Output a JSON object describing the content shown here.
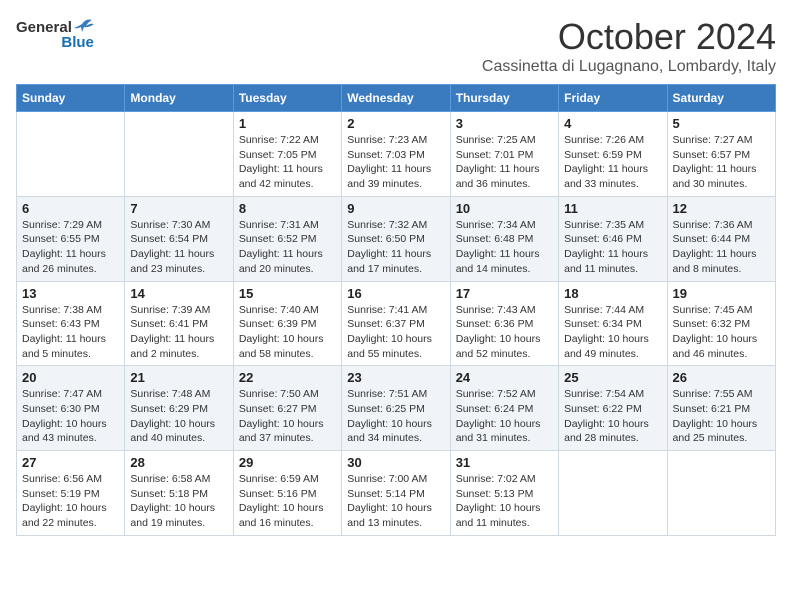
{
  "logo": {
    "general": "General",
    "blue": "Blue"
  },
  "header": {
    "month": "October 2024",
    "location": "Cassinetta di Lugagnano, Lombardy, Italy"
  },
  "weekdays": [
    "Sunday",
    "Monday",
    "Tuesday",
    "Wednesday",
    "Thursday",
    "Friday",
    "Saturday"
  ],
  "weeks": [
    [
      {
        "day": "",
        "info": ""
      },
      {
        "day": "",
        "info": ""
      },
      {
        "day": "1",
        "info": "Sunrise: 7:22 AM\nSunset: 7:05 PM\nDaylight: 11 hours and 42 minutes."
      },
      {
        "day": "2",
        "info": "Sunrise: 7:23 AM\nSunset: 7:03 PM\nDaylight: 11 hours and 39 minutes."
      },
      {
        "day": "3",
        "info": "Sunrise: 7:25 AM\nSunset: 7:01 PM\nDaylight: 11 hours and 36 minutes."
      },
      {
        "day": "4",
        "info": "Sunrise: 7:26 AM\nSunset: 6:59 PM\nDaylight: 11 hours and 33 minutes."
      },
      {
        "day": "5",
        "info": "Sunrise: 7:27 AM\nSunset: 6:57 PM\nDaylight: 11 hours and 30 minutes."
      }
    ],
    [
      {
        "day": "6",
        "info": "Sunrise: 7:29 AM\nSunset: 6:55 PM\nDaylight: 11 hours and 26 minutes."
      },
      {
        "day": "7",
        "info": "Sunrise: 7:30 AM\nSunset: 6:54 PM\nDaylight: 11 hours and 23 minutes."
      },
      {
        "day": "8",
        "info": "Sunrise: 7:31 AM\nSunset: 6:52 PM\nDaylight: 11 hours and 20 minutes."
      },
      {
        "day": "9",
        "info": "Sunrise: 7:32 AM\nSunset: 6:50 PM\nDaylight: 11 hours and 17 minutes."
      },
      {
        "day": "10",
        "info": "Sunrise: 7:34 AM\nSunset: 6:48 PM\nDaylight: 11 hours and 14 minutes."
      },
      {
        "day": "11",
        "info": "Sunrise: 7:35 AM\nSunset: 6:46 PM\nDaylight: 11 hours and 11 minutes."
      },
      {
        "day": "12",
        "info": "Sunrise: 7:36 AM\nSunset: 6:44 PM\nDaylight: 11 hours and 8 minutes."
      }
    ],
    [
      {
        "day": "13",
        "info": "Sunrise: 7:38 AM\nSunset: 6:43 PM\nDaylight: 11 hours and 5 minutes."
      },
      {
        "day": "14",
        "info": "Sunrise: 7:39 AM\nSunset: 6:41 PM\nDaylight: 11 hours and 2 minutes."
      },
      {
        "day": "15",
        "info": "Sunrise: 7:40 AM\nSunset: 6:39 PM\nDaylight: 10 hours and 58 minutes."
      },
      {
        "day": "16",
        "info": "Sunrise: 7:41 AM\nSunset: 6:37 PM\nDaylight: 10 hours and 55 minutes."
      },
      {
        "day": "17",
        "info": "Sunrise: 7:43 AM\nSunset: 6:36 PM\nDaylight: 10 hours and 52 minutes."
      },
      {
        "day": "18",
        "info": "Sunrise: 7:44 AM\nSunset: 6:34 PM\nDaylight: 10 hours and 49 minutes."
      },
      {
        "day": "19",
        "info": "Sunrise: 7:45 AM\nSunset: 6:32 PM\nDaylight: 10 hours and 46 minutes."
      }
    ],
    [
      {
        "day": "20",
        "info": "Sunrise: 7:47 AM\nSunset: 6:30 PM\nDaylight: 10 hours and 43 minutes."
      },
      {
        "day": "21",
        "info": "Sunrise: 7:48 AM\nSunset: 6:29 PM\nDaylight: 10 hours and 40 minutes."
      },
      {
        "day": "22",
        "info": "Sunrise: 7:50 AM\nSunset: 6:27 PM\nDaylight: 10 hours and 37 minutes."
      },
      {
        "day": "23",
        "info": "Sunrise: 7:51 AM\nSunset: 6:25 PM\nDaylight: 10 hours and 34 minutes."
      },
      {
        "day": "24",
        "info": "Sunrise: 7:52 AM\nSunset: 6:24 PM\nDaylight: 10 hours and 31 minutes."
      },
      {
        "day": "25",
        "info": "Sunrise: 7:54 AM\nSunset: 6:22 PM\nDaylight: 10 hours and 28 minutes."
      },
      {
        "day": "26",
        "info": "Sunrise: 7:55 AM\nSunset: 6:21 PM\nDaylight: 10 hours and 25 minutes."
      }
    ],
    [
      {
        "day": "27",
        "info": "Sunrise: 6:56 AM\nSunset: 5:19 PM\nDaylight: 10 hours and 22 minutes."
      },
      {
        "day": "28",
        "info": "Sunrise: 6:58 AM\nSunset: 5:18 PM\nDaylight: 10 hours and 19 minutes."
      },
      {
        "day": "29",
        "info": "Sunrise: 6:59 AM\nSunset: 5:16 PM\nDaylight: 10 hours and 16 minutes."
      },
      {
        "day": "30",
        "info": "Sunrise: 7:00 AM\nSunset: 5:14 PM\nDaylight: 10 hours and 13 minutes."
      },
      {
        "day": "31",
        "info": "Sunrise: 7:02 AM\nSunset: 5:13 PM\nDaylight: 10 hours and 11 minutes."
      },
      {
        "day": "",
        "info": ""
      },
      {
        "day": "",
        "info": ""
      }
    ]
  ]
}
